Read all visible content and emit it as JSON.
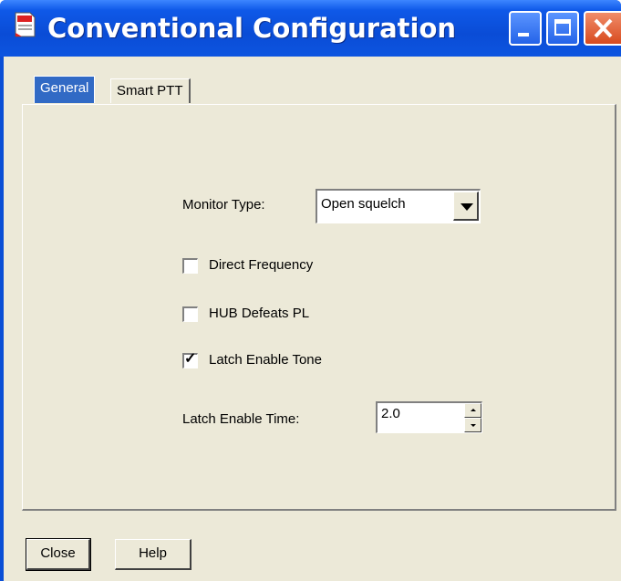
{
  "window": {
    "title": "Conventional Configuration",
    "icon": "document-icon",
    "controls": [
      "minimize-icon",
      "maximize-icon",
      "close-icon"
    ]
  },
  "tabs": [
    {
      "label": "General",
      "selected": true
    },
    {
      "label": "Smart PTT",
      "selected": false
    }
  ],
  "general": {
    "monitor_type_label": "Monitor Type:",
    "monitor_type_value": "Open squelch",
    "direct_frequency_label": "Direct Frequency",
    "direct_frequency_checked": false,
    "hub_defeats_pl_label": "HUB Defeats PL",
    "hub_defeats_pl_checked": false,
    "latch_enable_tone_label": "Latch Enable Tone",
    "latch_enable_tone_checked": true,
    "latch_enable_time_label": "Latch Enable Time:",
    "latch_enable_time_value": "2.0"
  },
  "buttons": {
    "close_label": "Close",
    "help_label": "Help"
  },
  "colors": {
    "titlebar": "#0a4cd6",
    "selected_tab": "#316ac5",
    "dialog_face": "#ece9d8",
    "close_button": "#d84a1e"
  }
}
